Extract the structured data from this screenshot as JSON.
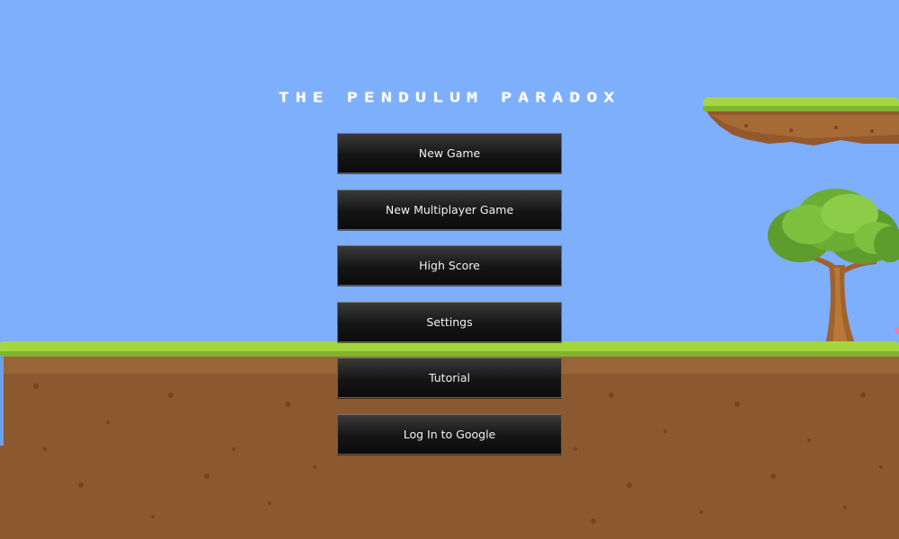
{
  "game": {
    "title": "The Pendulum Paradox"
  },
  "menu": {
    "items": [
      {
        "label": "New Game"
      },
      {
        "label": "New Multiplayer Game"
      },
      {
        "label": "High Score"
      },
      {
        "label": "Settings"
      },
      {
        "label": "Tutorial"
      },
      {
        "label": "Log In to Google"
      }
    ]
  },
  "colors": {
    "sky": "#7daffc",
    "grass": "#a5d640",
    "dirt": "#8b5830",
    "button": "#151515"
  }
}
